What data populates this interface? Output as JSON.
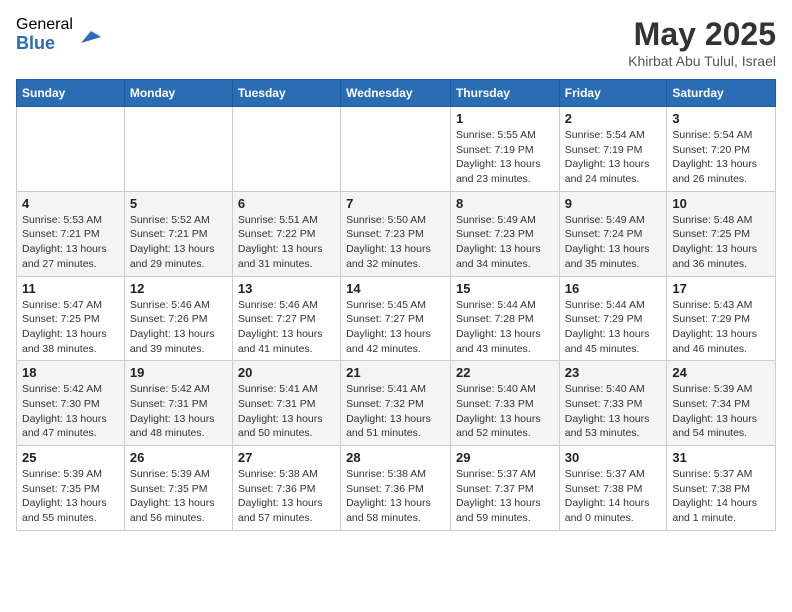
{
  "header": {
    "logo_general": "General",
    "logo_blue": "Blue",
    "month_title": "May 2025",
    "location": "Khirbat Abu Tulul, Israel"
  },
  "days_of_week": [
    "Sunday",
    "Monday",
    "Tuesday",
    "Wednesday",
    "Thursday",
    "Friday",
    "Saturday"
  ],
  "weeks": [
    [
      {
        "day": "",
        "content": ""
      },
      {
        "day": "",
        "content": ""
      },
      {
        "day": "",
        "content": ""
      },
      {
        "day": "",
        "content": ""
      },
      {
        "day": "1",
        "content": "Sunrise: 5:55 AM\nSunset: 7:19 PM\nDaylight: 13 hours\nand 23 minutes."
      },
      {
        "day": "2",
        "content": "Sunrise: 5:54 AM\nSunset: 7:19 PM\nDaylight: 13 hours\nand 24 minutes."
      },
      {
        "day": "3",
        "content": "Sunrise: 5:54 AM\nSunset: 7:20 PM\nDaylight: 13 hours\nand 26 minutes."
      }
    ],
    [
      {
        "day": "4",
        "content": "Sunrise: 5:53 AM\nSunset: 7:21 PM\nDaylight: 13 hours\nand 27 minutes."
      },
      {
        "day": "5",
        "content": "Sunrise: 5:52 AM\nSunset: 7:21 PM\nDaylight: 13 hours\nand 29 minutes."
      },
      {
        "day": "6",
        "content": "Sunrise: 5:51 AM\nSunset: 7:22 PM\nDaylight: 13 hours\nand 31 minutes."
      },
      {
        "day": "7",
        "content": "Sunrise: 5:50 AM\nSunset: 7:23 PM\nDaylight: 13 hours\nand 32 minutes."
      },
      {
        "day": "8",
        "content": "Sunrise: 5:49 AM\nSunset: 7:23 PM\nDaylight: 13 hours\nand 34 minutes."
      },
      {
        "day": "9",
        "content": "Sunrise: 5:49 AM\nSunset: 7:24 PM\nDaylight: 13 hours\nand 35 minutes."
      },
      {
        "day": "10",
        "content": "Sunrise: 5:48 AM\nSunset: 7:25 PM\nDaylight: 13 hours\nand 36 minutes."
      }
    ],
    [
      {
        "day": "11",
        "content": "Sunrise: 5:47 AM\nSunset: 7:25 PM\nDaylight: 13 hours\nand 38 minutes."
      },
      {
        "day": "12",
        "content": "Sunrise: 5:46 AM\nSunset: 7:26 PM\nDaylight: 13 hours\nand 39 minutes."
      },
      {
        "day": "13",
        "content": "Sunrise: 5:46 AM\nSunset: 7:27 PM\nDaylight: 13 hours\nand 41 minutes."
      },
      {
        "day": "14",
        "content": "Sunrise: 5:45 AM\nSunset: 7:27 PM\nDaylight: 13 hours\nand 42 minutes."
      },
      {
        "day": "15",
        "content": "Sunrise: 5:44 AM\nSunset: 7:28 PM\nDaylight: 13 hours\nand 43 minutes."
      },
      {
        "day": "16",
        "content": "Sunrise: 5:44 AM\nSunset: 7:29 PM\nDaylight: 13 hours\nand 45 minutes."
      },
      {
        "day": "17",
        "content": "Sunrise: 5:43 AM\nSunset: 7:29 PM\nDaylight: 13 hours\nand 46 minutes."
      }
    ],
    [
      {
        "day": "18",
        "content": "Sunrise: 5:42 AM\nSunset: 7:30 PM\nDaylight: 13 hours\nand 47 minutes."
      },
      {
        "day": "19",
        "content": "Sunrise: 5:42 AM\nSunset: 7:31 PM\nDaylight: 13 hours\nand 48 minutes."
      },
      {
        "day": "20",
        "content": "Sunrise: 5:41 AM\nSunset: 7:31 PM\nDaylight: 13 hours\nand 50 minutes."
      },
      {
        "day": "21",
        "content": "Sunrise: 5:41 AM\nSunset: 7:32 PM\nDaylight: 13 hours\nand 51 minutes."
      },
      {
        "day": "22",
        "content": "Sunrise: 5:40 AM\nSunset: 7:33 PM\nDaylight: 13 hours\nand 52 minutes."
      },
      {
        "day": "23",
        "content": "Sunrise: 5:40 AM\nSunset: 7:33 PM\nDaylight: 13 hours\nand 53 minutes."
      },
      {
        "day": "24",
        "content": "Sunrise: 5:39 AM\nSunset: 7:34 PM\nDaylight: 13 hours\nand 54 minutes."
      }
    ],
    [
      {
        "day": "25",
        "content": "Sunrise: 5:39 AM\nSunset: 7:35 PM\nDaylight: 13 hours\nand 55 minutes."
      },
      {
        "day": "26",
        "content": "Sunrise: 5:39 AM\nSunset: 7:35 PM\nDaylight: 13 hours\nand 56 minutes."
      },
      {
        "day": "27",
        "content": "Sunrise: 5:38 AM\nSunset: 7:36 PM\nDaylight: 13 hours\nand 57 minutes."
      },
      {
        "day": "28",
        "content": "Sunrise: 5:38 AM\nSunset: 7:36 PM\nDaylight: 13 hours\nand 58 minutes."
      },
      {
        "day": "29",
        "content": "Sunrise: 5:37 AM\nSunset: 7:37 PM\nDaylight: 13 hours\nand 59 minutes."
      },
      {
        "day": "30",
        "content": "Sunrise: 5:37 AM\nSunset: 7:38 PM\nDaylight: 14 hours\nand 0 minutes."
      },
      {
        "day": "31",
        "content": "Sunrise: 5:37 AM\nSunset: 7:38 PM\nDaylight: 14 hours\nand 1 minute."
      }
    ]
  ]
}
